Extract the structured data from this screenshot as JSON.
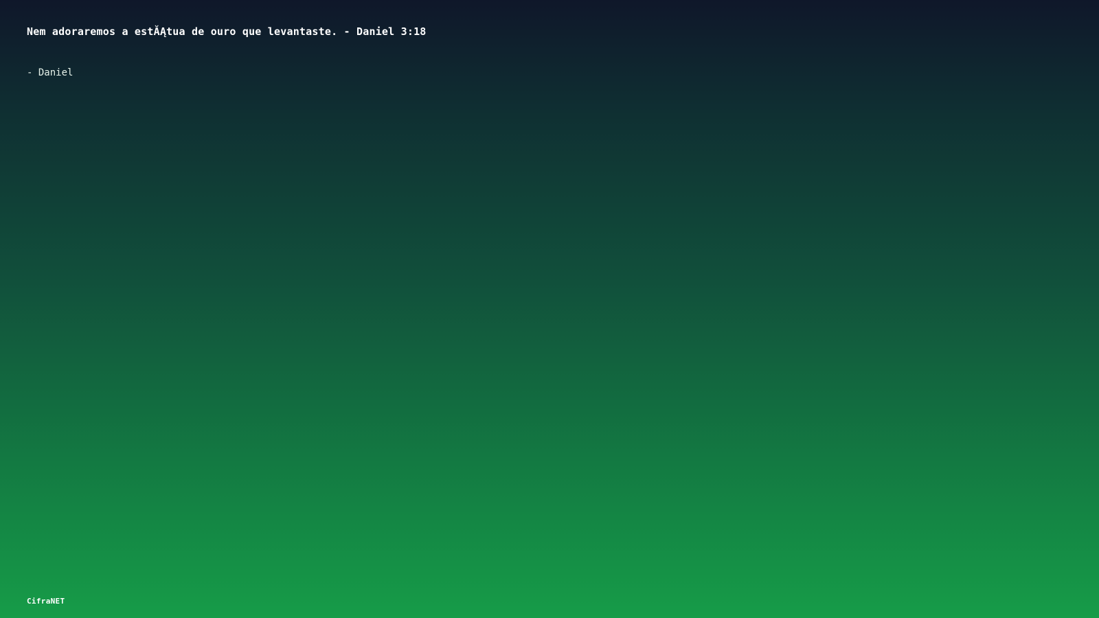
{
  "slide": {
    "quote": "Nem adoraremos a estĂĄtua de ouro que levantaste. - Daniel 3:18",
    "author": "- Daniel",
    "brand": "CifraNET"
  },
  "colors": {
    "gradient_top": "#0f172a",
    "gradient_bottom": "#169c48",
    "text": "#ffffff"
  }
}
